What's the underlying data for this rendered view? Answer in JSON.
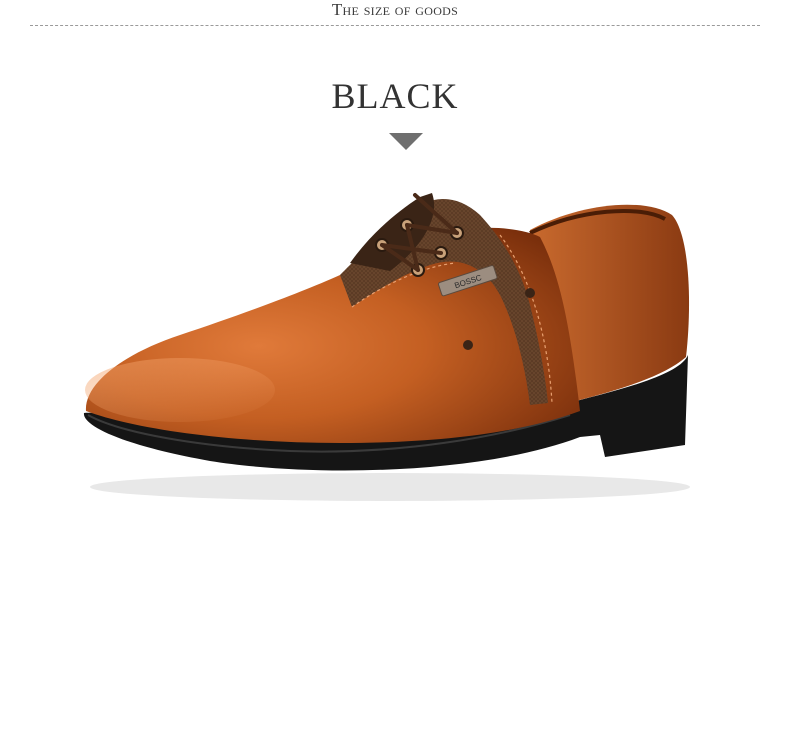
{
  "header": {
    "section_title": "The size of goods"
  },
  "product": {
    "color_label": "BLACK",
    "badge_text": "BOSSC",
    "image_subject": "brown leather oxford shoe",
    "colors": {
      "leather": "#b8561e",
      "leather_dark": "#7a2f0c",
      "fabric": "#5b3a24",
      "sole": "#151515"
    }
  },
  "arrow_icon": "triangle-down-icon"
}
